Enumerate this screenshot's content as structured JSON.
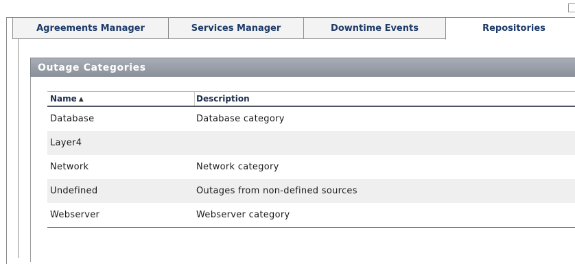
{
  "tabs": [
    {
      "label": "Agreements Manager",
      "active": false
    },
    {
      "label": "Services Manager",
      "active": false
    },
    {
      "label": "Downtime Events",
      "active": false
    },
    {
      "label": "Repositories",
      "active": true
    }
  ],
  "panel": {
    "title": "Outage Categories"
  },
  "table": {
    "columns": [
      {
        "label": "Name",
        "sort": "ascending",
        "sort_icon": "sort-ascending-icon"
      },
      {
        "label": "Description"
      }
    ],
    "rows": [
      {
        "name": "Database",
        "description": "Database category"
      },
      {
        "name": "Layer4",
        "description": ""
      },
      {
        "name": "Network",
        "description": "Network category"
      },
      {
        "name": "Undefined",
        "description": "Outages from non-defined sources"
      },
      {
        "name": "Webserver",
        "description": "Webserver category"
      }
    ]
  },
  "colors": {
    "tab_text": "#1d3a68",
    "header_bar": "#9aa0aa",
    "row_alt": "#efefef",
    "border": "#8c8c8c"
  }
}
